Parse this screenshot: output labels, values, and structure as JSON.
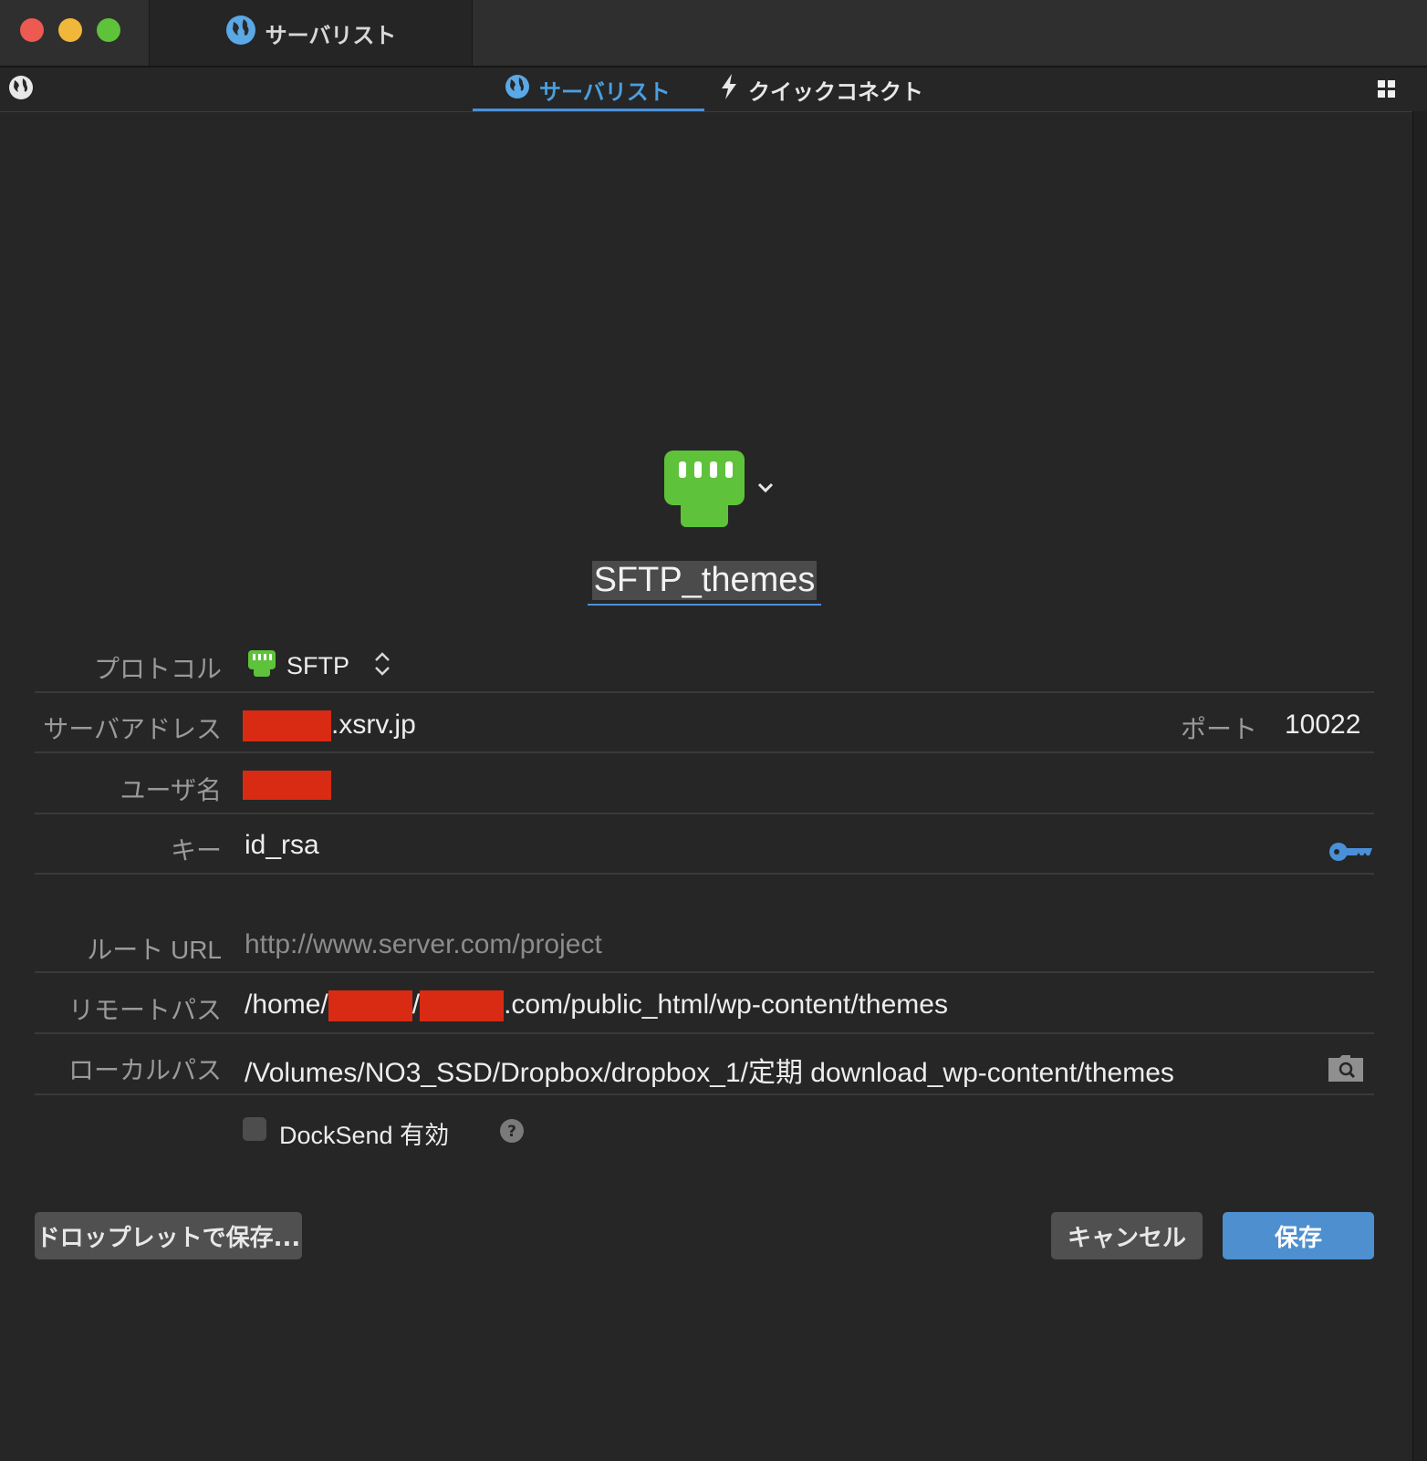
{
  "window": {
    "tab_title": "サーバリスト"
  },
  "toolbar": {
    "tabs": [
      {
        "label": "サーバリスト",
        "active": true
      },
      {
        "label": "クイックコネクト",
        "active": false
      }
    ]
  },
  "server": {
    "name": "SFTP_themes"
  },
  "form": {
    "protocol_label": "プロトコル",
    "protocol_value": "SFTP",
    "address_label": "サーバアドレス",
    "address_suffix": ".xsrv.jp",
    "port_label": "ポート",
    "port_value": "10022",
    "username_label": "ユーザ名",
    "key_label": "キー",
    "key_value": "id_rsa",
    "root_url_label": "ルート URL",
    "root_url_placeholder": "http://www.server.com/project",
    "remote_path_label": "リモートパス",
    "remote_path_prefix": "/home/",
    "remote_path_sep": "/",
    "remote_path_suffix": ".com/public_html/wp-content/themes",
    "local_path_label": "ローカルパス",
    "local_path_value": "/Volumes/NO3_SSD/Dropbox/dropbox_1/定期 download_wp-content/themes",
    "docksend_label": "DockSend 有効",
    "docksend_checked": false
  },
  "buttons": {
    "droplet_label": "ドロップレットで保存...",
    "cancel_label": "キャンセル",
    "save_label": "保存"
  },
  "colors": {
    "accent": "#4a90d9",
    "sftp_green": "#5ec23a",
    "redaction": "#d92b13",
    "close": "#ec5a52",
    "minimize": "#f0b73a",
    "zoom": "#5ec23a"
  },
  "icons": [
    "globe-icon",
    "bolt-icon",
    "grid-icon",
    "sftp-plug-icon",
    "chevron-down-icon",
    "stepper-icon",
    "key-icon",
    "folder-search-icon",
    "help-icon"
  ]
}
